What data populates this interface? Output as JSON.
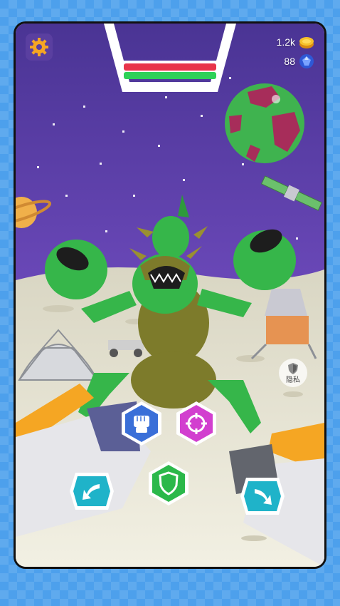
{
  "hud": {
    "coins": "1.2k",
    "gems": "88"
  },
  "health": {
    "enemy_fraction": 1.0,
    "player_fraction": 1.0,
    "enemy_color": "#e8344a",
    "player_color": "#2ed158"
  },
  "privacy": {
    "label": "隐私"
  },
  "icons": {
    "settings": "gear-icon",
    "coin": "coin-icon",
    "gem": "gem-icon",
    "attack": "fist-icon",
    "target": "crosshair-icon",
    "defend": "shield-icon",
    "dodge_left": "arrow-left-icon",
    "dodge_right": "arrow-right-icon",
    "privacy": "shield-icon"
  },
  "colors": {
    "sky": "#5b3aa8",
    "ground": "#e9e6d6",
    "monster": "#36b64a",
    "attack_button": "#3a6fd8",
    "target_button": "#d23fcf",
    "defend_button": "#2bb84a",
    "dodge_button": "#1fb3c9"
  }
}
